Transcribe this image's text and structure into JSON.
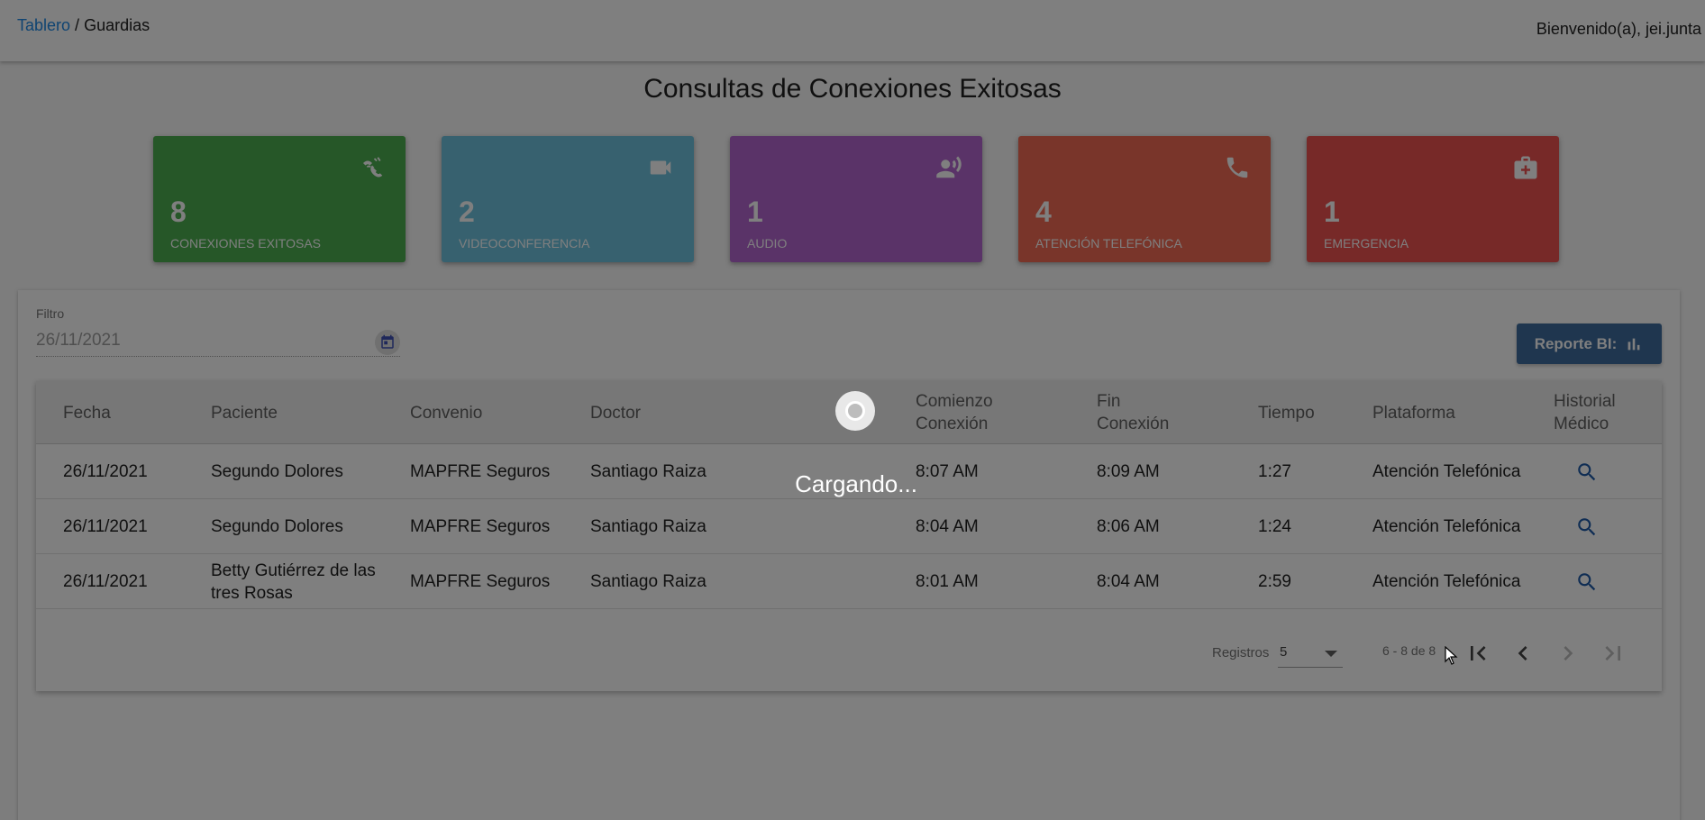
{
  "header": {
    "breadcrumb_link": "Tablero",
    "breadcrumb_separator": " / ",
    "breadcrumb_current": "Guardias",
    "welcome": "Bienvenido(a), jei.junta"
  },
  "page_title": "Consultas de Conexiones Exitosas",
  "cards": [
    {
      "count": "8",
      "label": "CONEXIONES EXITOSAS",
      "color": "#4caf50",
      "icon": "connection-icon"
    },
    {
      "count": "2",
      "label": "VIDEOCONFERENCIA",
      "color": "#6fc3df",
      "icon": "videocam-icon"
    },
    {
      "count": "1",
      "label": "AUDIO",
      "color": "#b466d1",
      "icon": "record-voice-icon"
    },
    {
      "count": "4",
      "label": "ATENCIÓN TELEFÓNICA",
      "color": "#f26a55",
      "icon": "phone-icon"
    },
    {
      "count": "1",
      "label": "EMERGENCIA",
      "color": "#ef5350",
      "icon": "medical-kit-icon"
    }
  ],
  "filter": {
    "label": "Filtro",
    "value": "26/11/2021"
  },
  "report_button": {
    "label": "Reporte BI:"
  },
  "table": {
    "columns": [
      "Fecha",
      "Paciente",
      "Convenio",
      "Doctor",
      "Comienzo Conexión",
      "Fin Conexión",
      "Tiempo",
      "Plataforma",
      "Historial Médico"
    ],
    "rows": [
      {
        "fecha": "26/11/2021",
        "paciente": "Segundo Dolores",
        "convenio": "MAPFRE Seguros",
        "doctor": "Santiago Raiza",
        "comienzo": "8:07 AM",
        "fin": "8:09 AM",
        "tiempo": "1:27",
        "plataforma": "Atención Telefónica"
      },
      {
        "fecha": "26/11/2021",
        "paciente": "Segundo Dolores",
        "convenio": "MAPFRE Seguros",
        "doctor": "Santiago Raiza",
        "comienzo": "8:04 AM",
        "fin": "8:06 AM",
        "tiempo": "1:24",
        "plataforma": "Atención Telefónica"
      },
      {
        "fecha": "26/11/2021",
        "paciente": "Betty Gutiérrez de las tres Rosas",
        "convenio": "MAPFRE Seguros",
        "doctor": "Santiago Raiza",
        "comienzo": "8:01 AM",
        "fin": "8:04 AM",
        "tiempo": "2:59",
        "plataforma": "Atención Telefónica"
      }
    ]
  },
  "pagination": {
    "registros_label": "Registros",
    "page_size": "5",
    "range": "6 - 8 de 8"
  },
  "loading": {
    "text": "Cargando..."
  },
  "colors": {
    "link": "#1e88e5",
    "report_button": "#3f6c9e",
    "overlay": "rgba(0,0,0,0.5)"
  }
}
